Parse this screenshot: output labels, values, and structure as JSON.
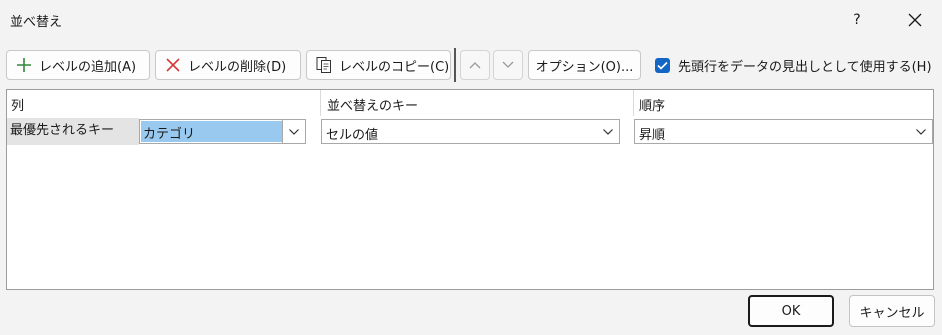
{
  "window": {
    "title": "並べ替え",
    "help_label": "?"
  },
  "toolbar": {
    "add_level_label": "レベルの追加(A)",
    "delete_level_label": "レベルの削除(D)",
    "copy_level_label": "レベルのコピー(C)",
    "options_label": "オプション(O)..."
  },
  "header_checkbox": {
    "label": "先頭行をデータの見出しとして使用する(H)",
    "checked": true
  },
  "grid": {
    "columns": [
      "列",
      "並べ替えのキー",
      "順序"
    ],
    "rows": [
      {
        "label": "最優先されるキー",
        "column_value": "カテゴリ",
        "sort_on_value": "セルの値",
        "order_value": "昇順"
      }
    ]
  },
  "footer": {
    "ok_label": "OK",
    "cancel_label": "キャンセル"
  },
  "colors": {
    "accent": "#1366c4",
    "selection": "#99c9ef",
    "delete_icon": "#d63b3b",
    "add_icon": "#2f8a3a"
  }
}
